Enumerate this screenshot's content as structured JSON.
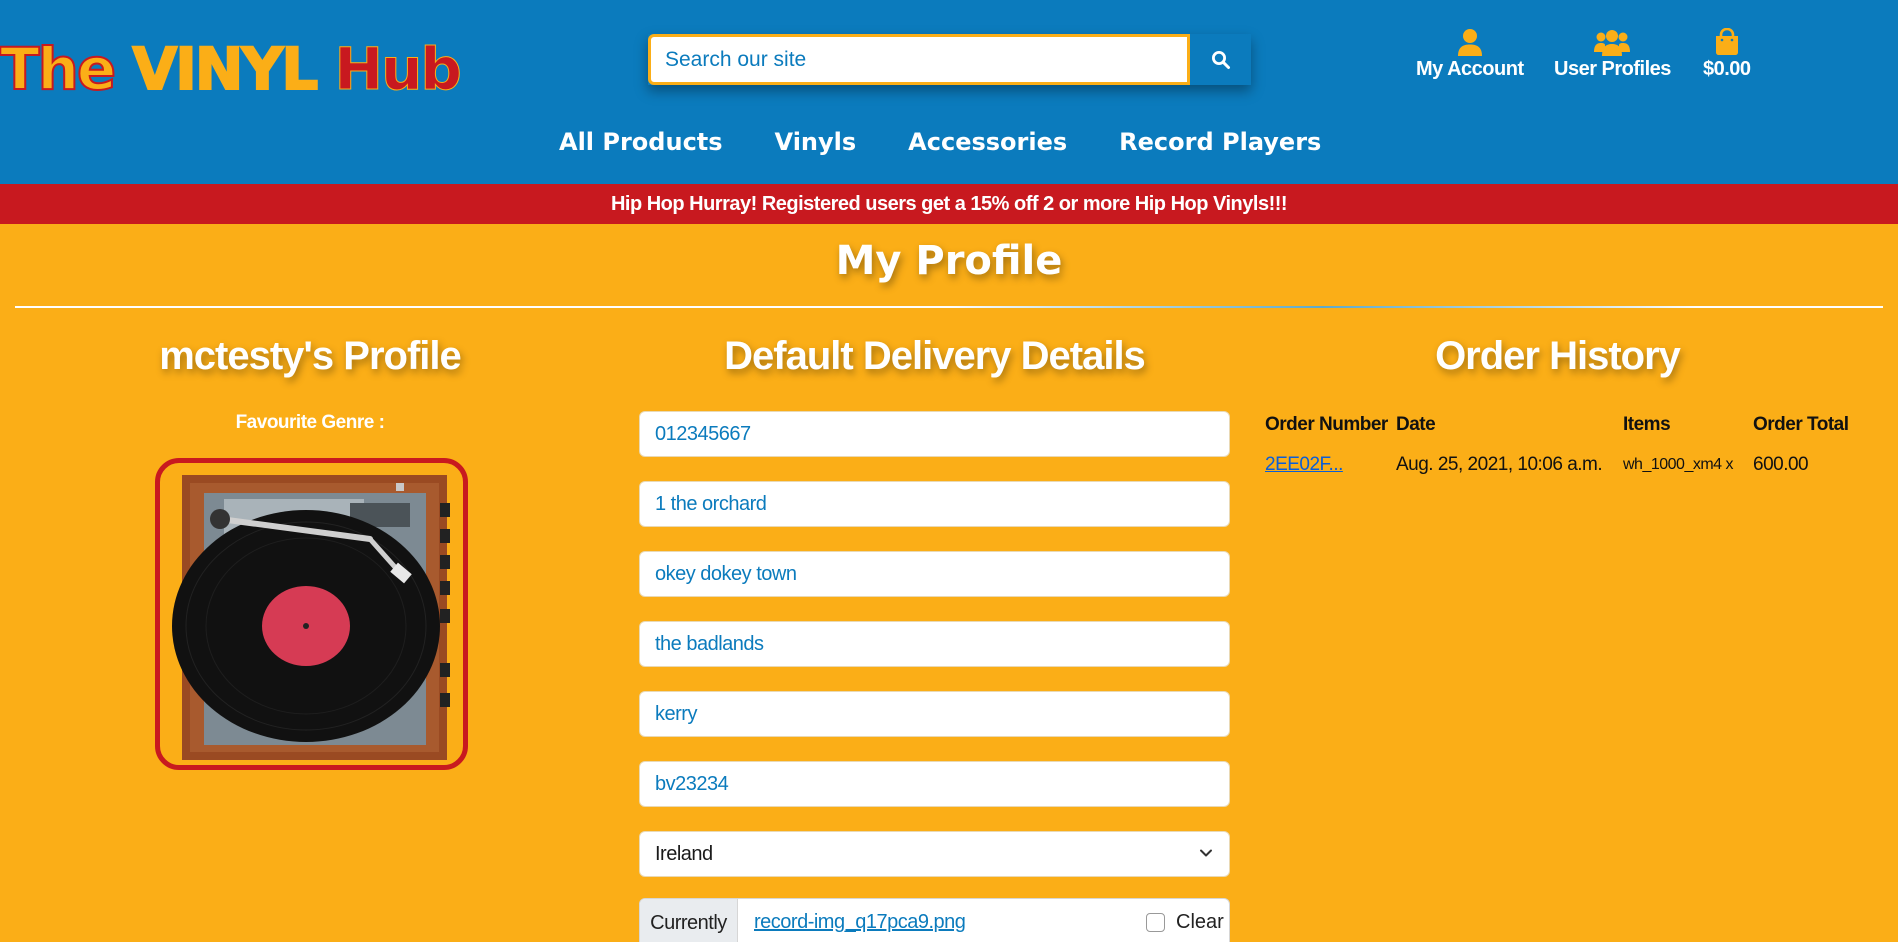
{
  "header": {
    "logo": {
      "part1": "The ",
      "part2": "VINYL",
      "part3": " Hub"
    },
    "search": {
      "placeholder": "Search our site"
    },
    "links": {
      "account": "My Account",
      "profiles": "User Profiles",
      "cart": "$0.00"
    },
    "nav": [
      "All Products",
      "Vinyls",
      "Accessories",
      "Record Players"
    ]
  },
  "banner": "Hip Hop Hurray! Registered users get a 15% off 2 or more Hip Hop Vinyls!!!",
  "page_title": "My Profile",
  "profile": {
    "title": "mctesty's Profile",
    "genre_label": "Favourite Genre :"
  },
  "delivery": {
    "title": "Default Delivery Details",
    "phone": "012345667",
    "street1": "1 the orchard",
    "street2": "okey dokey town",
    "town": "the badlands",
    "county": "kerry",
    "postcode": "bv23234",
    "country": "Ireland",
    "file_current_label": "Currently",
    "file_name": "record-img_q17pca9.png",
    "file_clear_label": "Clear"
  },
  "orders": {
    "title": "Order History",
    "headers": [
      "Order Number",
      "Date",
      "Items",
      "Order Total"
    ],
    "rows": [
      {
        "number": "2EE02F...",
        "date": "Aug. 25, 2021, 10:06 a.m.",
        "items": "wh_1000_xm4 x",
        "total": "600.00"
      }
    ]
  },
  "colors": {
    "blue": "#0b7bbd",
    "yellow": "#fbae17",
    "red": "#c8191f"
  },
  "icons": {
    "search": "search-icon",
    "account": "user-icon",
    "profiles": "users-icon",
    "cart": "shopping-bag-icon"
  }
}
